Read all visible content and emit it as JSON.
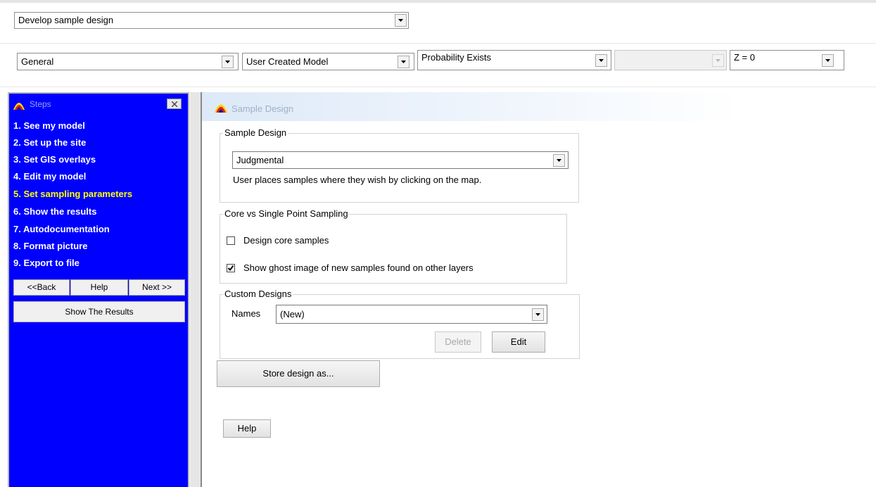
{
  "toolbar": {
    "task_select": {
      "value": "Develop sample design"
    },
    "row2": {
      "category_select": {
        "value": "General"
      },
      "model_select": {
        "value": "User Created Model"
      },
      "probability_select": {
        "value": "Probability Exists"
      },
      "empty_select": {
        "value": ""
      },
      "z_select": {
        "value": "Z = 0"
      }
    }
  },
  "steps": {
    "title": "Steps",
    "items": [
      {
        "label": "1.  See my model",
        "active": false
      },
      {
        "label": "2.  Set up the site",
        "active": false
      },
      {
        "label": "3.  Set GIS overlays",
        "active": false
      },
      {
        "label": "4.  Edit my model",
        "active": false
      },
      {
        "label": "5.  Set sampling parameters",
        "active": true
      },
      {
        "label": "6.  Show the results",
        "active": false
      },
      {
        "label": "7.  Autodocumentation",
        "active": false
      },
      {
        "label": "8.  Format picture",
        "active": false
      },
      {
        "label": "9.  Export to file",
        "active": false
      }
    ],
    "back_label": "<<Back",
    "help_label": "Help",
    "next_label": "Next >>",
    "show_results_label": "Show The Results"
  },
  "main": {
    "title": "Sample Design",
    "sample_design": {
      "legend": "Sample Design",
      "select_value": "Judgmental",
      "description": "User places samples where they wish by clicking on the map."
    },
    "core": {
      "legend": "Core vs Single Point Sampling",
      "design_core_label": "Design core samples",
      "design_core_checked": false,
      "ghost_label": "Show ghost image of new samples found on other layers",
      "ghost_checked": true
    },
    "custom": {
      "legend": "Custom Designs",
      "names_label": "Names",
      "names_value": "(New)",
      "delete_label": "Delete",
      "edit_label": "Edit"
    },
    "store_label": "Store design as...",
    "help_label": "Help"
  },
  "colors": {
    "steps_background": "#0000ff",
    "active_step": "#ffff00",
    "header_gradient_start": "#dde9f8"
  }
}
